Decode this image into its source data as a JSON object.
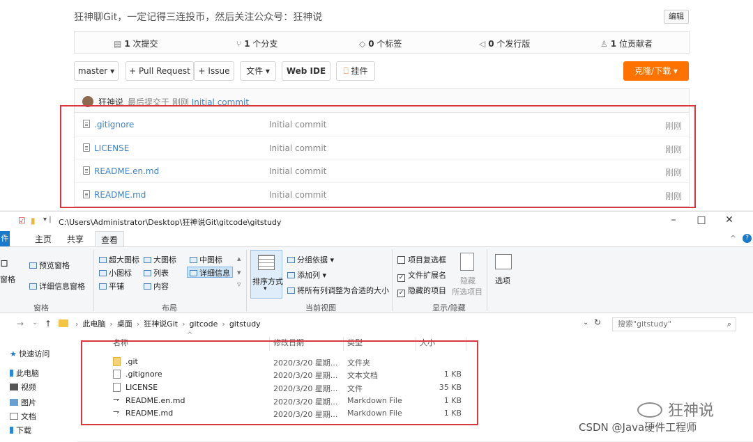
{
  "gitee": {
    "description": "狂神聊Git，一定记得三连投币，然后关注公众号：狂神说",
    "edit_label": "编辑",
    "stats": [
      {
        "icon": "commit-icon",
        "count": "1",
        "label": "次提交"
      },
      {
        "icon": "branch-icon",
        "count": "1",
        "label": "个分支"
      },
      {
        "icon": "tag-icon",
        "count": "0",
        "label": "个标签"
      },
      {
        "icon": "release-icon",
        "count": "0",
        "label": "个发行版"
      },
      {
        "icon": "contributor-icon",
        "count": "1",
        "label": "位贡献者"
      }
    ],
    "branch_label": "master",
    "pull_request_label": "+ Pull Request",
    "issue_label": "+ Issue",
    "file_menu_label": "文件",
    "web_ide_label": "Web IDE",
    "widget_label": "挂件",
    "clone_label": "克隆/下载",
    "last_commit": {
      "author": "狂神说",
      "text": "最后提交于",
      "time": "刚刚",
      "message": "Initial commit"
    },
    "files": [
      {
        "name": ".gitignore",
        "commit": "Initial commit",
        "time": "刚刚"
      },
      {
        "name": "LICENSE",
        "commit": "Initial commit",
        "time": "刚刚"
      },
      {
        "name": "README.en.md",
        "commit": "Initial commit",
        "time": "刚刚"
      },
      {
        "name": "README.md",
        "commit": "Initial commit",
        "time": "刚刚"
      }
    ]
  },
  "explorer": {
    "path": "C:\\Users\\Administrator\\Desktop\\狂神说Git\\gitcode\\gitstudy",
    "tabs": {
      "file": "件",
      "home": "主页",
      "share": "共享",
      "view": "查看"
    },
    "ribbon": {
      "pane_preview": "预览窗格",
      "pane_nav": "窗格",
      "pane_details": "详细信息窗格",
      "group_pane": "窗格",
      "layout": {
        "extra_large": "超大图标",
        "large": "大图标",
        "medium": "中图标",
        "small": "小图标",
        "list": "列表",
        "details": "详细信息",
        "tiles": "平铺",
        "content": "内容"
      },
      "group_layout": "布局",
      "sort_by": "排序方式",
      "group_by": "分组依据",
      "add_column": "添加列",
      "fit_columns": "将所有列调整为合适的大小",
      "group_current_view": "当前视图",
      "item_checkboxes": "项目复选框",
      "file_extensions": "文件扩展名",
      "hidden_items": "隐藏的项目",
      "hide": "隐藏",
      "selected_items": "所选项目",
      "group_show_hide": "显示/隐藏",
      "options": "选项"
    },
    "breadcrumb": [
      "此电脑",
      "桌面",
      "狂神说Git",
      "gitcode",
      "gitstudy"
    ],
    "search_placeholder": "搜索\"gitstudy\"",
    "nav_pane": [
      "快速访问",
      "此电脑",
      "视频",
      "图片",
      "文档",
      "下载"
    ],
    "columns": {
      "name": "名称",
      "date": "修改日期",
      "type": "类型",
      "size": "大小"
    },
    "rows": [
      {
        "name": ".git",
        "date": "2020/3/20 星期...",
        "type": "文件夹",
        "size": "",
        "icon": "folder-icon"
      },
      {
        "name": ".gitignore",
        "date": "2020/3/20 星期...",
        "type": "文本文档",
        "size": "1 KB",
        "icon": "text-file-icon"
      },
      {
        "name": "LICENSE",
        "date": "2020/3/20 星期...",
        "type": "文件",
        "size": "35 KB",
        "icon": "file-icon"
      },
      {
        "name": "README.en.md",
        "date": "2020/3/20 星期...",
        "type": "Markdown File",
        "size": "1 KB",
        "icon": "markdown-icon"
      },
      {
        "name": "README.md",
        "date": "2020/3/20 星期...",
        "type": "Markdown File",
        "size": "1 KB",
        "icon": "markdown-icon"
      }
    ]
  },
  "watermark": {
    "brand": "狂神说",
    "csdn": "CSDN @Java硬件工程师"
  },
  "colors": {
    "clone_button": "#fe7300",
    "highlight_border": "#d9363e",
    "link": "#4183c4",
    "file_tab": "#1979ca"
  }
}
